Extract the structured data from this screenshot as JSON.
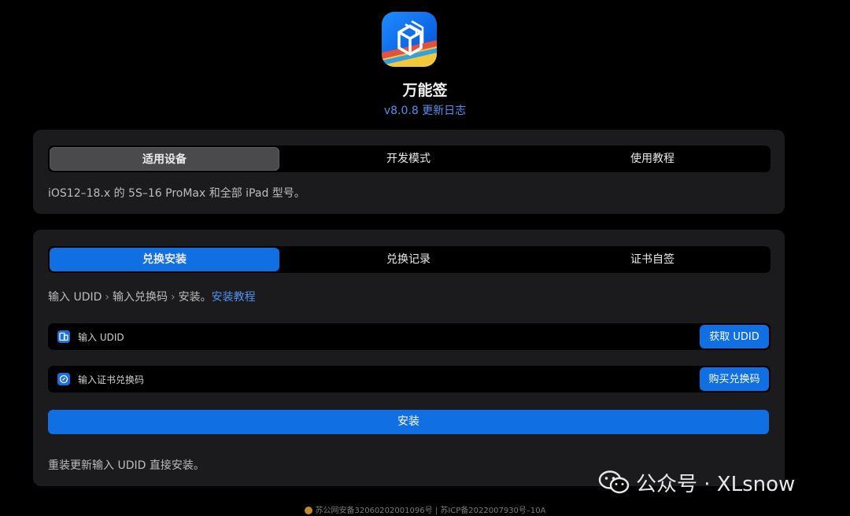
{
  "app": {
    "name": "万能签",
    "version": "v8.0.8",
    "changelog_link": "更新日志"
  },
  "device_card": {
    "tabs": [
      {
        "label": "适用设备",
        "active": true
      },
      {
        "label": "开发模式",
        "active": false
      },
      {
        "label": "使用教程",
        "active": false
      }
    ],
    "description": "iOS12–18.x 的 5S–16 ProMax 和全部 iPad 型号。"
  },
  "install_card": {
    "tabs": [
      {
        "label": "兑换安装",
        "active": true
      },
      {
        "label": "兑换记录",
        "active": false
      },
      {
        "label": "证书自签",
        "active": false
      }
    ],
    "steps": [
      "输入 UDID",
      "输入兑换码",
      "安装。"
    ],
    "steps_link": "安装教程",
    "udid_field": {
      "placeholder": "输入 UDID",
      "value": "",
      "button": "获取 UDID",
      "icon": "device-icon"
    },
    "code_field": {
      "placeholder": "输入证书兑换码",
      "value": "",
      "button": "购买兑换码",
      "icon": "ticket-icon"
    },
    "install_button": "安装",
    "note": "重装更新输入 UDID 直接安装。"
  },
  "watermark": {
    "text": "公众号 · XLsnow",
    "icon": "wechat-icon"
  },
  "footer": {
    "police_record": "苏公网安备32060202001096号",
    "divider": "|",
    "icp_record": "苏ICP备2022007930号–10A"
  },
  "colors": {
    "accent": "#0f6fe3",
    "link": "#4f93f0",
    "card_bg": "#1b1b1d",
    "page_bg": "#000000"
  }
}
